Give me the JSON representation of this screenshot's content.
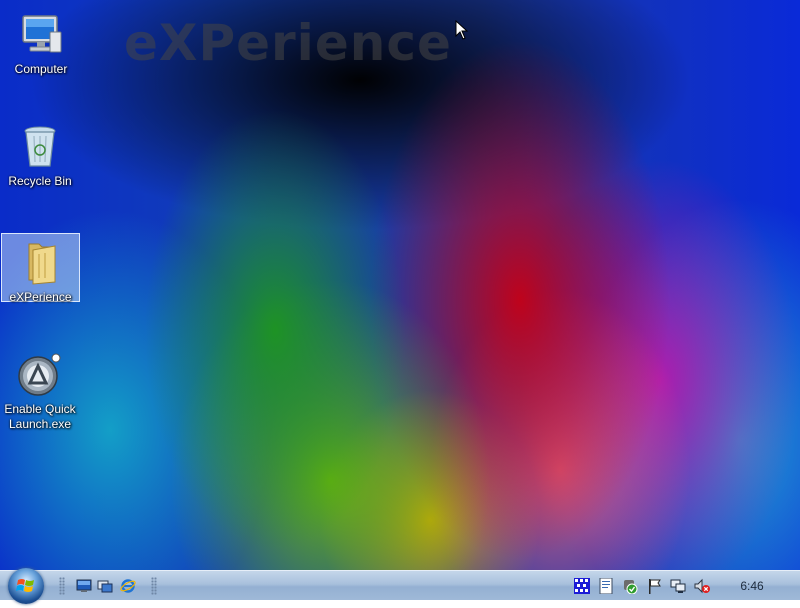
{
  "desktop": {
    "watermark": "eXPerience",
    "icons": [
      {
        "label": "Computer",
        "icon": "computer-icon"
      },
      {
        "label": "Recycle Bin",
        "icon": "recycle-bin-icon"
      },
      {
        "label": "eXPerience",
        "icon": "folder-icon",
        "selected": true
      },
      {
        "label": "Enable Quick Launch.exe",
        "icon": "app-launcher-icon"
      }
    ]
  },
  "taskbar": {
    "start_icon": "windows-start-orb-icon",
    "quick_launch": [
      "show-desktop-icon",
      "switch-windows-icon",
      "internet-explorer-icon"
    ],
    "tray": [
      "display-settings-icon",
      "document-icon",
      "security-shield-icon",
      "action-center-flag-icon",
      "network-icon",
      "volume-muted-icon"
    ],
    "clock": "6:46"
  },
  "colors": {
    "taskbar_top": "#c4d6ea",
    "taskbar_bottom": "#9fb9d8",
    "selection": "#bed7f5"
  }
}
